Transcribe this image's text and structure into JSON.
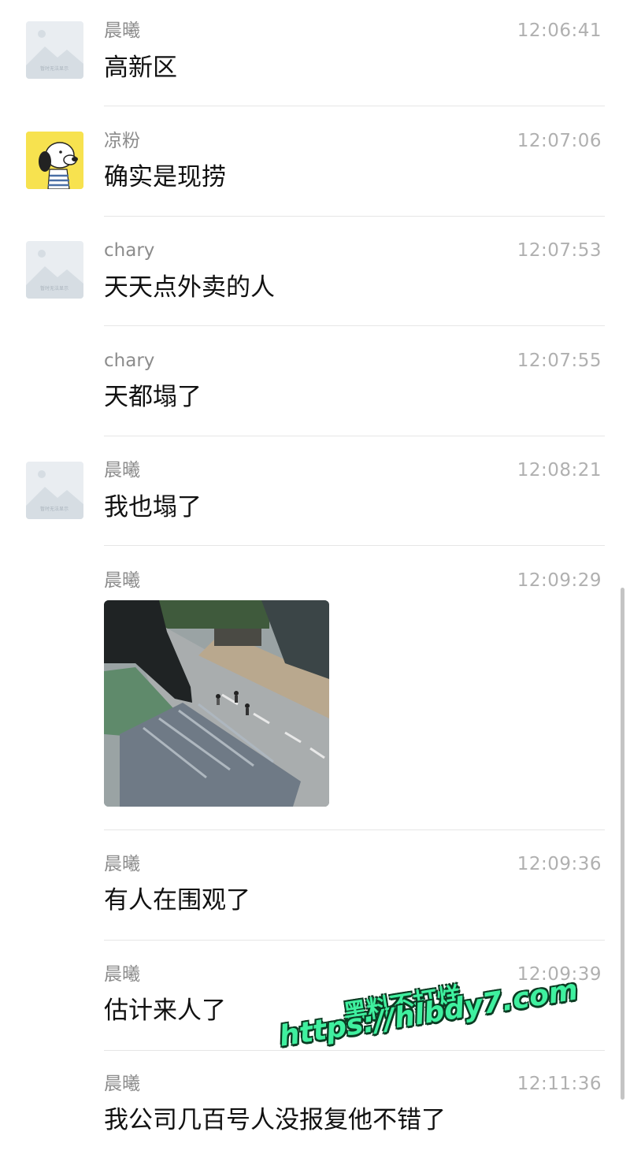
{
  "messages": [
    {
      "sender": "晨曦",
      "time": "12:06:41",
      "text": "高新区",
      "avatar": "placeholder"
    },
    {
      "sender": "凉粉",
      "time": "12:07:06",
      "text": "确实是现捞",
      "avatar": "snoopy"
    },
    {
      "sender": "chary",
      "time": "12:07:53",
      "text": "天天点外卖的人",
      "avatar": "placeholder"
    },
    {
      "sender": "chary",
      "time": "12:07:55",
      "text": "天都塌了",
      "avatar": "none"
    },
    {
      "sender": "晨曦",
      "time": "12:08:21",
      "text": "我也塌了",
      "avatar": "placeholder"
    },
    {
      "sender": "晨曦",
      "time": "12:09:29",
      "text": "",
      "image": "street-view-photo",
      "avatar": "none"
    },
    {
      "sender": "晨曦",
      "time": "12:09:36",
      "text": "有人在围观了",
      "avatar": "none"
    },
    {
      "sender": "晨曦",
      "time": "12:09:39",
      "text": "估计来人了",
      "avatar": "none"
    },
    {
      "sender": "晨曦",
      "time": "12:11:36",
      "text": "我公司几百号人没报复他不错了",
      "avatar": "none"
    }
  ],
  "placeholder_avatar_caption": "暂时无法显示",
  "watermark": {
    "line1": "黑料不打烊",
    "line2": "https://hlbdy7.com"
  },
  "colors": {
    "name": "#8c8c8c",
    "time": "#b0b0b0",
    "text": "#111111",
    "divider": "#e6e6e6",
    "watermark": "#3ff09f"
  }
}
